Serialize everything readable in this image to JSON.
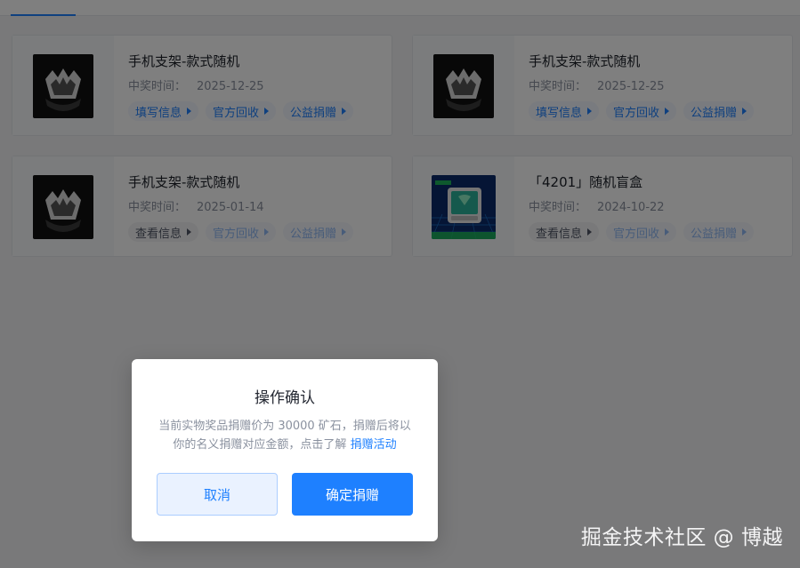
{
  "colors": {
    "accent": "#1e80ff",
    "page_bg": "#f2f3f5",
    "overlay": "rgba(0,0,0,0.5)"
  },
  "prizes": [
    {
      "title": "手机支架-款式随机",
      "time_label": "中奖时间：",
      "time": "2025-12-25",
      "image": "phone-holder-image",
      "actions": [
        {
          "label": "填写信息",
          "state": "active"
        },
        {
          "label": "官方回收",
          "state": "active"
        },
        {
          "label": "公益捐赠",
          "state": "active"
        }
      ]
    },
    {
      "title": "手机支架-款式随机",
      "time_label": "中奖时间：",
      "time": "2025-12-25",
      "image": "phone-holder-image",
      "actions": [
        {
          "label": "填写信息",
          "state": "active"
        },
        {
          "label": "官方回收",
          "state": "active"
        },
        {
          "label": "公益捐赠",
          "state": "active"
        }
      ]
    },
    {
      "title": "手机支架-款式随机",
      "time_label": "中奖时间：",
      "time": "2025-01-14",
      "image": "phone-holder-image",
      "actions": [
        {
          "label": "查看信息",
          "state": "gray"
        },
        {
          "label": "官方回收",
          "state": "disabled"
        },
        {
          "label": "公益捐赠",
          "state": "disabled"
        }
      ]
    },
    {
      "title": "「4201」随机盲盒",
      "time_label": "中奖时间：",
      "time": "2024-10-22",
      "image": "blind-box-image",
      "actions": [
        {
          "label": "查看信息",
          "state": "gray"
        },
        {
          "label": "官方回收",
          "state": "disabled"
        },
        {
          "label": "公益捐赠",
          "state": "disabled"
        }
      ]
    }
  ],
  "modal": {
    "title": "操作确认",
    "body_text": "当前实物奖品捐赠价为 30000 矿石，捐赠后将以你的名义捐赠对应金额，点击了解",
    "body_link": "捐赠活动",
    "cancel_label": "取消",
    "confirm_label": "确定捐赠"
  },
  "watermark": "掘金技术社区 @ 博越"
}
